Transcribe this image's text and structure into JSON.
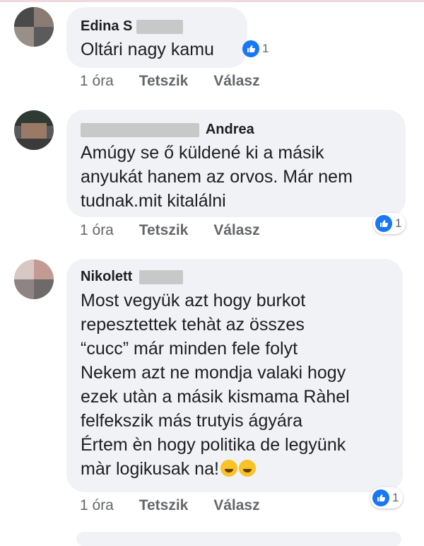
{
  "comments": [
    {
      "author": "Edina S",
      "text": "Oltári nagy kamu",
      "time": "1 óra",
      "like_label": "Tetszik",
      "reply_label": "Válasz",
      "reactions": {
        "icon": "like-icon",
        "count": "1"
      }
    },
    {
      "author": "Andrea",
      "text": "Amúgy se ő küldené ki a másik\nanyukát hanem az orvos. Már nem\ntudnak.mit kitalálni",
      "time": "1 óra",
      "like_label": "Tetszik",
      "reply_label": "Válasz",
      "reactions": {
        "icon": "like-icon",
        "count": "1"
      }
    },
    {
      "author": "Nikolett",
      "text": "Most vegyük azt hogy burkot\nrepesztettek tehàt az összes\n“cucc” már minden fele folyt\nNekem azt ne mondja valaki hogy\nezek utàn a másik kismama Ràhel\nfelfekszik más trutyis ágyára\nÉrtem èn hogy politika de legyünk\nmàr logikusak na!",
      "time": "1 óra",
      "like_label": "Tetszik",
      "reply_label": "Válasz",
      "reactions": {
        "icon": "like-icon",
        "count": "1"
      },
      "trailing_emoji": [
        "rolling-laughing-emoji",
        "rolling-laughing-emoji"
      ]
    }
  ],
  "colors": {
    "like_blue": "#1877f2",
    "bubble_gray": "#f0f2f5",
    "meta_gray": "#65676b"
  }
}
